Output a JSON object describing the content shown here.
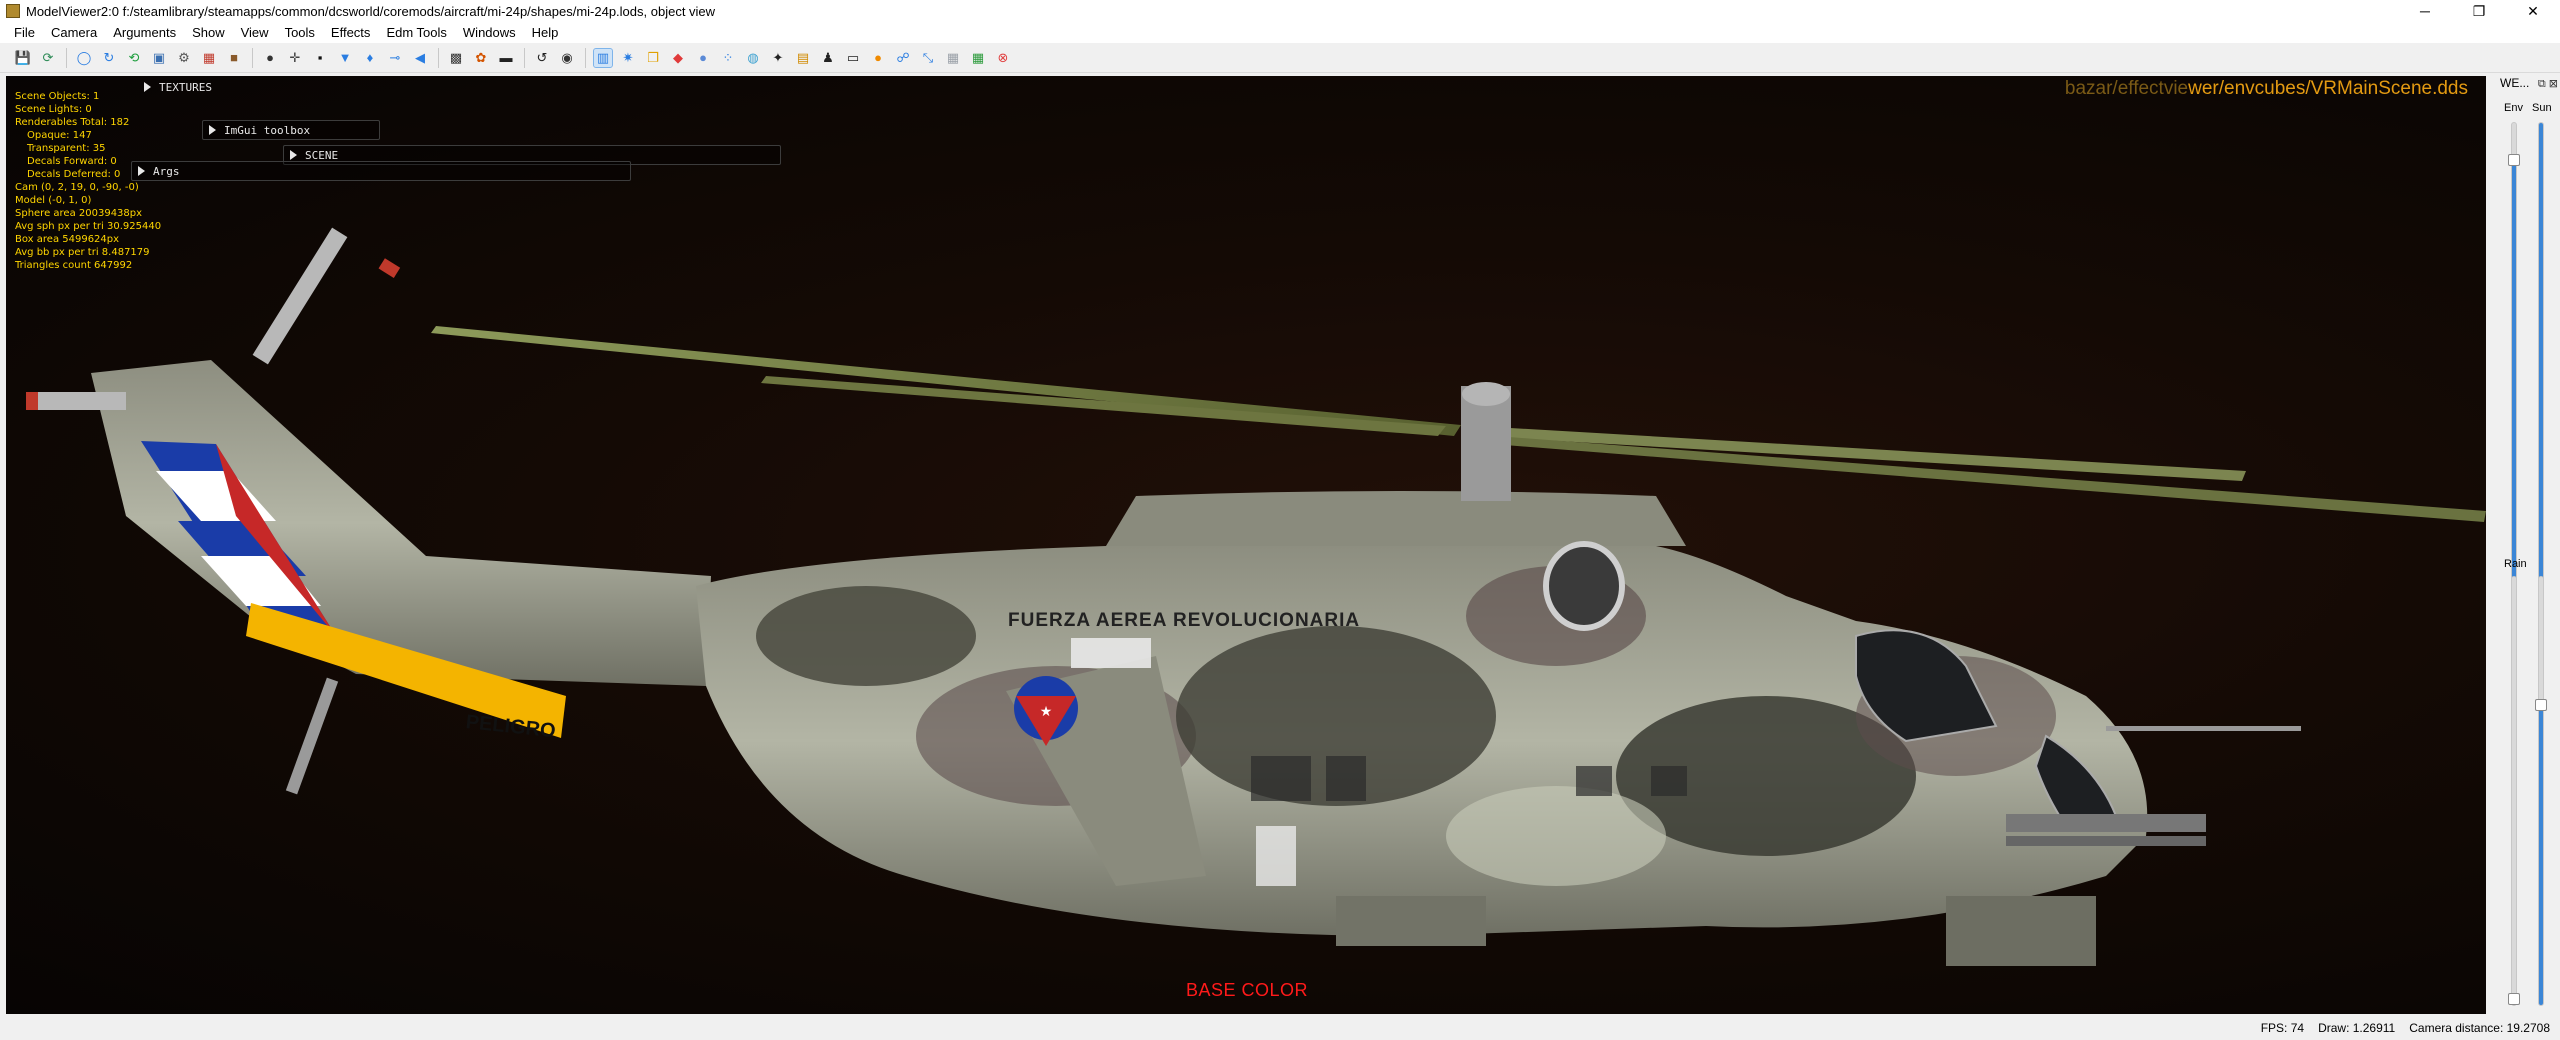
{
  "window": {
    "title": "ModelViewer2:0 f:/steamlibrary/steamapps/common/dcsworld/coremods/aircraft/mi-24p/shapes/mi-24p.lods, object view",
    "minimize": "─",
    "maximize": "❐",
    "close": "✕"
  },
  "menu": [
    "File",
    "Camera",
    "Arguments",
    "Show",
    "View",
    "Tools",
    "Effects",
    "Edm Tools",
    "Windows",
    "Help"
  ],
  "toolbar": {
    "icons": [
      {
        "name": "save-icon",
        "glyph": "💾",
        "color": "#2e6bc6"
      },
      {
        "name": "reload-icon",
        "glyph": "⟳",
        "color": "#2e8b57"
      },
      {
        "name": "separator"
      },
      {
        "name": "circle-blue-icon",
        "glyph": "◯",
        "color": "#2a7de1"
      },
      {
        "name": "rotate-icon",
        "glyph": "↻",
        "color": "#2a7de1"
      },
      {
        "name": "refresh-green-icon",
        "glyph": "⟲",
        "color": "#1e9e3e"
      },
      {
        "name": "image-icon",
        "glyph": "▣",
        "color": "#3a6fb0"
      },
      {
        "name": "gear-icon",
        "glyph": "⚙",
        "color": "#555555"
      },
      {
        "name": "camera-icon",
        "glyph": "▦",
        "color": "#c0392b"
      },
      {
        "name": "box-brown-icon",
        "glyph": "■",
        "color": "#8a5a2b"
      },
      {
        "name": "separator"
      },
      {
        "name": "person-icon",
        "glyph": "●",
        "color": "#333333"
      },
      {
        "name": "crosshair-icon",
        "glyph": "✛",
        "color": "#444444"
      },
      {
        "name": "frame-icon",
        "glyph": "▪",
        "color": "#111111"
      },
      {
        "name": "funnel-icon",
        "glyph": "▼",
        "color": "#2a7de1"
      },
      {
        "name": "lamp-icon",
        "glyph": "♦",
        "color": "#2a7de1"
      },
      {
        "name": "axis-icon",
        "glyph": "⊸",
        "color": "#2a7de1"
      },
      {
        "name": "speaker-icon",
        "glyph": "◀",
        "color": "#2a7de1"
      },
      {
        "name": "separator"
      },
      {
        "name": "portrait-icon",
        "glyph": "▩",
        "color": "#333333"
      },
      {
        "name": "palette-icon",
        "glyph": "✿",
        "color": "#d35400"
      },
      {
        "name": "terminal-icon",
        "glyph": "▬",
        "color": "#222222"
      },
      {
        "name": "separator"
      },
      {
        "name": "undo-icon",
        "glyph": "↺",
        "color": "#222222"
      },
      {
        "name": "record-icon",
        "glyph": "◉",
        "color": "#333333"
      },
      {
        "name": "separator"
      },
      {
        "name": "bar-chart-icon",
        "glyph": "▥",
        "color": "#2a7de1",
        "active": true
      },
      {
        "name": "snowflake-icon",
        "glyph": "✷",
        "color": "#2a7de1"
      },
      {
        "name": "copy-icon",
        "glyph": "❐",
        "color": "#e0a000"
      },
      {
        "name": "cube-red-icon",
        "glyph": "◆",
        "color": "#e03a3a"
      },
      {
        "name": "sphere-icon",
        "glyph": "●",
        "color": "#5b8ad6"
      },
      {
        "name": "grid-dots-icon",
        "glyph": "⁘",
        "color": "#2a7de1"
      },
      {
        "name": "globe-icon",
        "glyph": "◍",
        "color": "#3aa0d0"
      },
      {
        "name": "pin-icon",
        "glyph": "✦",
        "color": "#222222"
      },
      {
        "name": "picture-icon",
        "glyph": "▤",
        "color": "#d08a00"
      },
      {
        "name": "person2-icon",
        "glyph": "♟",
        "color": "#222222"
      },
      {
        "name": "car-icon",
        "glyph": "▭",
        "color": "#222222"
      },
      {
        "name": "orange-ball-icon",
        "glyph": "●",
        "color": "#f08a00"
      },
      {
        "name": "network-icon",
        "glyph": "☍",
        "color": "#2a7de1"
      },
      {
        "name": "transform-icon",
        "glyph": "⤡",
        "color": "#2a7de1"
      },
      {
        "name": "table-icon",
        "glyph": "▦",
        "color": "#9aa0a8"
      },
      {
        "name": "grid-icon",
        "glyph": "▦",
        "color": "#2a9a3a"
      },
      {
        "name": "stop-icon",
        "glyph": "⊗",
        "color": "#e04040"
      }
    ]
  },
  "overlay": {
    "stats": [
      {
        "text": "Scene Objects: 1",
        "indent": false
      },
      {
        "text": "Scene Lights:  0",
        "indent": false
      },
      {
        "text": "Renderables Total: 182",
        "indent": false
      },
      {
        "text": "Opaque: 147",
        "indent": true
      },
      {
        "text": "Transparent: 35",
        "indent": true
      },
      {
        "text": "Decals Forward: 0",
        "indent": true
      },
      {
        "text": "Decals Deferred: 0",
        "indent": true
      },
      {
        "text": "Cam (0, 2, 19, 0, -90, -0)",
        "indent": false
      },
      {
        "text": "Model (-0, 1, 0)",
        "indent": false
      },
      {
        "text": "Sphere area 20039438px",
        "indent": false
      },
      {
        "text": "Avg sph px per tri 30.925440",
        "indent": false
      },
      {
        "text": "Box area 5499624px",
        "indent": false
      },
      {
        "text": "Avg bb px per tri 8.487179",
        "indent": false
      },
      {
        "text": "Triangles count 647992",
        "indent": false
      }
    ],
    "textures_header": "TEXTURES",
    "imgui_toolbox": "ImGui toolbox",
    "scene_header": "SCENE",
    "args_header": "Args",
    "env_path_dim": "bazar/effectvie",
    "env_path": "wer/envcubes/VRMainScene.dds",
    "base_color": "BASE COLOR",
    "model_markings": {
      "tail_band": "PELIGRO",
      "fuselage_text": "FUERZA AEREA REVOLUCIONARIA"
    }
  },
  "right_panel": {
    "title": "WE...",
    "icons": "⧉ ⊠",
    "env_label": "Env",
    "sun_label": "Sun",
    "rain_label": "Rain",
    "env_level": 0.92,
    "sun_level": 1.0,
    "rain_level": 0.0,
    "sun_lower_level": 0.7
  },
  "status": {
    "fps": "FPS: 74",
    "draw": "Draw:  1.26911",
    "camera": "Camera distance: 19.2708"
  }
}
